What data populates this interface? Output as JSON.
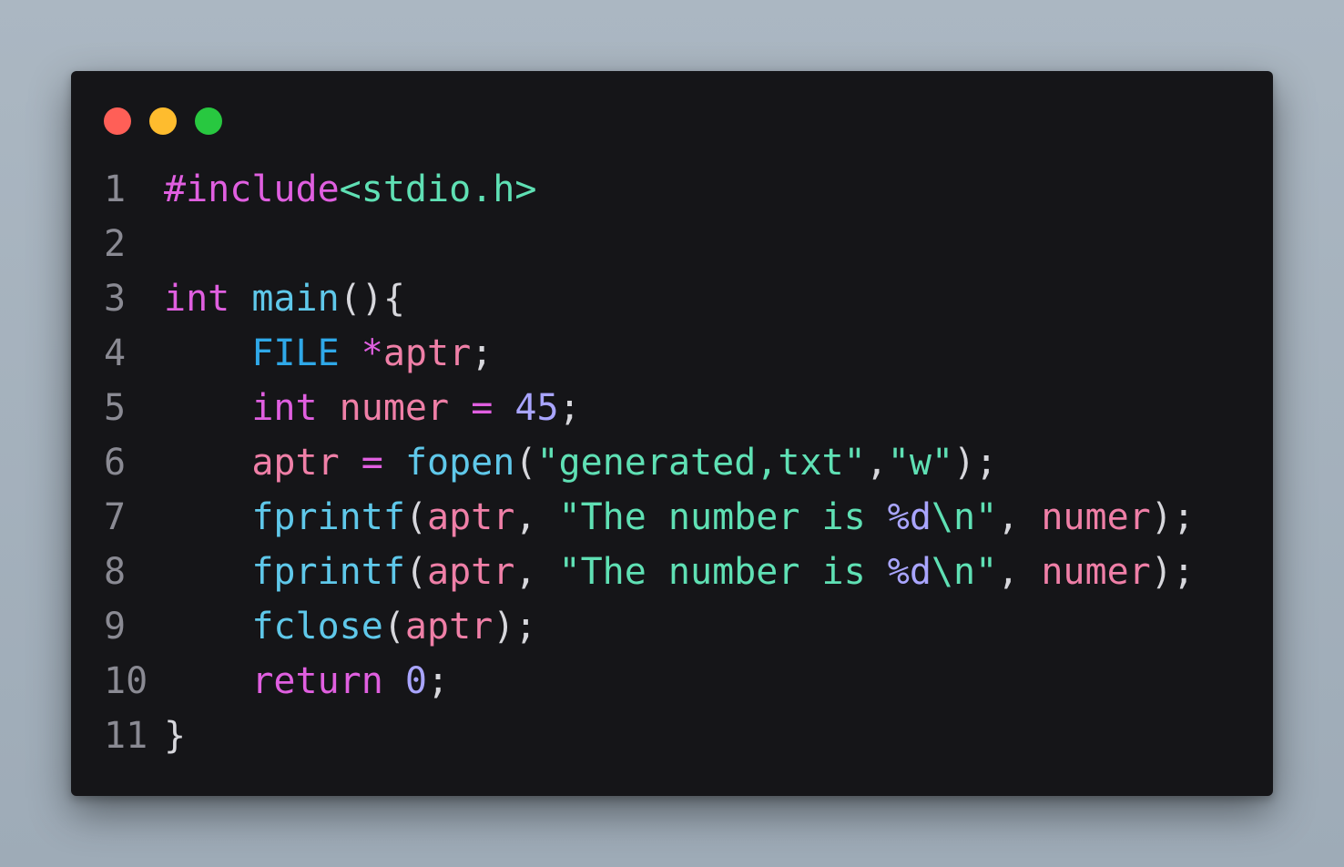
{
  "window": {
    "controls": [
      {
        "name": "close",
        "color": "#ff5f57"
      },
      {
        "name": "minimize",
        "color": "#febc2e"
      },
      {
        "name": "maximize",
        "color": "#28c840"
      }
    ]
  },
  "colors": {
    "background": "#a6b2bd",
    "editor": "#151518",
    "line_number": "#8a8a93",
    "plain": "#d7d7dc",
    "keyword": "#e05fe0",
    "function": "#5fc8ea",
    "type": "#2fa8e8",
    "variable": "#ef7fa7",
    "string": "#5fe0b4",
    "number": "#a9a5ff",
    "operator": "#e05fe0"
  },
  "code": {
    "lines": [
      {
        "n": "1",
        "tokens": [
          {
            "t": "#include",
            "c": "keyword"
          },
          {
            "t": "<stdio.h>",
            "c": "string"
          }
        ]
      },
      {
        "n": "2",
        "tokens": []
      },
      {
        "n": "3",
        "tokens": [
          {
            "t": "int",
            "c": "keyword"
          },
          {
            "t": " ",
            "c": "plain"
          },
          {
            "t": "main",
            "c": "function"
          },
          {
            "t": "(){",
            "c": "plain"
          }
        ]
      },
      {
        "n": "4",
        "tokens": [
          {
            "t": "    ",
            "c": "plain"
          },
          {
            "t": "FILE",
            "c": "type"
          },
          {
            "t": " ",
            "c": "plain"
          },
          {
            "t": "*",
            "c": "operator"
          },
          {
            "t": "aptr",
            "c": "variable"
          },
          {
            "t": ";",
            "c": "plain"
          }
        ]
      },
      {
        "n": "5",
        "tokens": [
          {
            "t": "    ",
            "c": "plain"
          },
          {
            "t": "int",
            "c": "keyword"
          },
          {
            "t": " ",
            "c": "plain"
          },
          {
            "t": "numer",
            "c": "variable"
          },
          {
            "t": " ",
            "c": "plain"
          },
          {
            "t": "=",
            "c": "operator"
          },
          {
            "t": " ",
            "c": "plain"
          },
          {
            "t": "45",
            "c": "number"
          },
          {
            "t": ";",
            "c": "plain"
          }
        ]
      },
      {
        "n": "6",
        "tokens": [
          {
            "t": "    ",
            "c": "plain"
          },
          {
            "t": "aptr",
            "c": "variable"
          },
          {
            "t": " ",
            "c": "plain"
          },
          {
            "t": "=",
            "c": "operator"
          },
          {
            "t": " ",
            "c": "plain"
          },
          {
            "t": "fopen",
            "c": "function"
          },
          {
            "t": "(",
            "c": "plain"
          },
          {
            "t": "\"generated,txt\"",
            "c": "string"
          },
          {
            "t": ",",
            "c": "plain"
          },
          {
            "t": "\"w\"",
            "c": "string"
          },
          {
            "t": ");",
            "c": "plain"
          }
        ]
      },
      {
        "n": "7",
        "tokens": [
          {
            "t": "    ",
            "c": "plain"
          },
          {
            "t": "fprintf",
            "c": "function"
          },
          {
            "t": "(",
            "c": "plain"
          },
          {
            "t": "aptr",
            "c": "variable"
          },
          {
            "t": ", ",
            "c": "plain"
          },
          {
            "t": "\"The number is ",
            "c": "string"
          },
          {
            "t": "%d",
            "c": "number"
          },
          {
            "t": "\\n",
            "c": "string"
          },
          {
            "t": "\"",
            "c": "string"
          },
          {
            "t": ", ",
            "c": "plain"
          },
          {
            "t": "numer",
            "c": "variable"
          },
          {
            "t": ");",
            "c": "plain"
          }
        ]
      },
      {
        "n": "8",
        "tokens": [
          {
            "t": "    ",
            "c": "plain"
          },
          {
            "t": "fprintf",
            "c": "function"
          },
          {
            "t": "(",
            "c": "plain"
          },
          {
            "t": "aptr",
            "c": "variable"
          },
          {
            "t": ", ",
            "c": "plain"
          },
          {
            "t": "\"The number is ",
            "c": "string"
          },
          {
            "t": "%d",
            "c": "number"
          },
          {
            "t": "\\n",
            "c": "string"
          },
          {
            "t": "\"",
            "c": "string"
          },
          {
            "t": ", ",
            "c": "plain"
          },
          {
            "t": "numer",
            "c": "variable"
          },
          {
            "t": ");",
            "c": "plain"
          }
        ]
      },
      {
        "n": "9",
        "tokens": [
          {
            "t": "    ",
            "c": "plain"
          },
          {
            "t": "fclose",
            "c": "function"
          },
          {
            "t": "(",
            "c": "plain"
          },
          {
            "t": "aptr",
            "c": "variable"
          },
          {
            "t": ");",
            "c": "plain"
          }
        ]
      },
      {
        "n": "10",
        "tokens": [
          {
            "t": "    ",
            "c": "plain"
          },
          {
            "t": "return",
            "c": "keyword"
          },
          {
            "t": " ",
            "c": "plain"
          },
          {
            "t": "0",
            "c": "number"
          },
          {
            "t": ";",
            "c": "plain"
          }
        ]
      },
      {
        "n": "11",
        "tokens": [
          {
            "t": "}",
            "c": "plain"
          }
        ]
      }
    ]
  }
}
